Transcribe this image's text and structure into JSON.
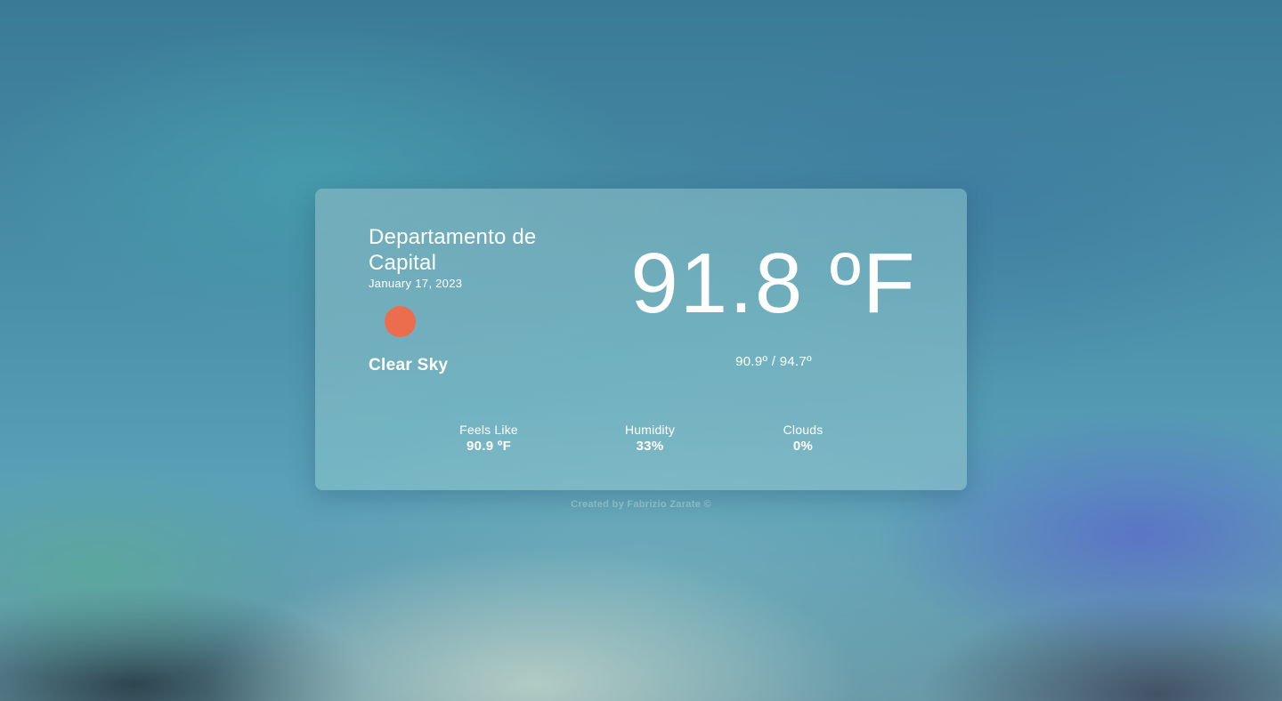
{
  "weather": {
    "location": "Departamento de Capital",
    "date": "January 17, 2023",
    "condition": "Clear Sky",
    "icon": "sun-icon",
    "icon_color": "#ec6c4e",
    "temperature": "91.8 ºF",
    "min_max": "90.9º / 94.7º"
  },
  "stats": {
    "feels_like": {
      "label": "Feels Like",
      "value": "90.9 ºF"
    },
    "humidity": {
      "label": "Humidity",
      "value": "33%"
    },
    "clouds": {
      "label": "Clouds",
      "value": "0%"
    }
  },
  "footer": {
    "credit": "Created by Fabrizio Zarate ©"
  }
}
